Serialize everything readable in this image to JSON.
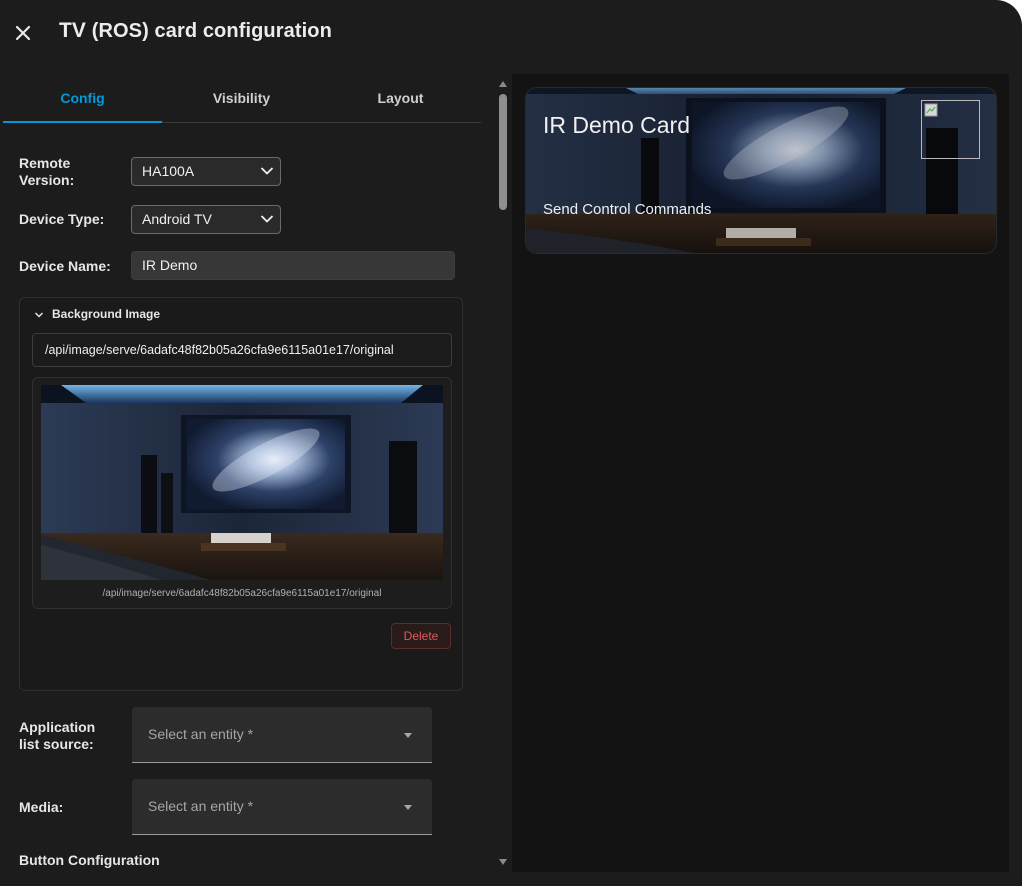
{
  "dialog": {
    "title_prefix": "TV",
    "title": "(ROS) card configuration"
  },
  "tabs": [
    {
      "label": "Config",
      "active": true
    },
    {
      "label": "Visibility",
      "active": false
    },
    {
      "label": "Layout",
      "active": false
    }
  ],
  "form": {
    "remote_version": {
      "label": "Remote Version:",
      "value": "HA100A"
    },
    "device_type": {
      "label": "Device Type:",
      "value": "Android TV"
    },
    "device_name": {
      "label": "Device Name:",
      "value": "IR Demo"
    },
    "background_image": {
      "header": "Background Image",
      "url": "/api/image/serve/6adafc48f82b05a26cfa9e6115a01e17/original",
      "caption": "/api/image/serve/6adafc48f82b05a26cfa9e6115a01e17/original",
      "delete_label": "Delete"
    },
    "app_list_source": {
      "label": "Application list source:",
      "placeholder": "Select an entity *"
    },
    "media": {
      "label": "Media:",
      "placeholder": "Select an entity *"
    },
    "button_configuration": "Button Configuration"
  },
  "preview": {
    "card_title": "IR Demo Card",
    "card_subtitle": "Send Control Commands"
  },
  "colors": {
    "accent": "#0398d6",
    "dialog_bg": "#1c1c1c",
    "delete": "#e05a5a"
  },
  "icons": [
    "close-icon",
    "chevron-down-icon",
    "dropdown-caret-icon"
  ]
}
